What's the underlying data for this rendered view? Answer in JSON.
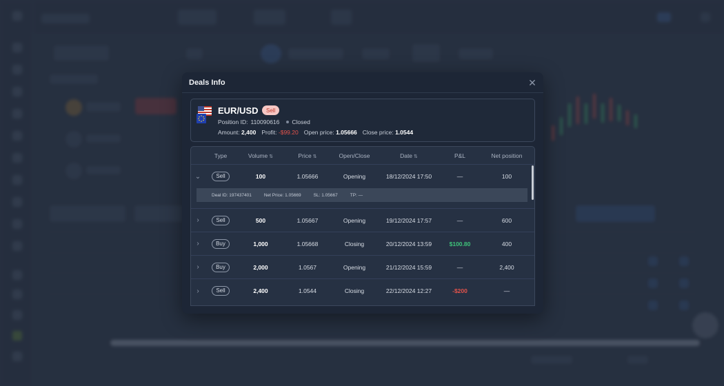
{
  "modal": {
    "title": "Deals Info",
    "close_icon": "close-icon"
  },
  "position": {
    "pair": "EUR/USD",
    "side": "Sell",
    "position_id_label": "Position ID:",
    "position_id": "110090616",
    "status": "Closed",
    "amount_label": "Amount:",
    "amount": "2,400",
    "profit_label": "Profit:",
    "profit": "-$99.20",
    "open_price_label": "Open price:",
    "open_price": "1.05666",
    "close_price_label": "Close price:",
    "close_price": "1.0544",
    "flag_icons": [
      "us-flag-icon",
      "eu-flag-icon"
    ]
  },
  "table": {
    "headers": {
      "type": "Type",
      "volume": "Volume",
      "price": "Price",
      "open_close": "Open/Close",
      "date": "Date",
      "pnl": "P&L",
      "net_position": "Net position"
    },
    "sort_icon": "sort-icon",
    "rows": [
      {
        "type": "Sell",
        "volume": "100",
        "price": "1.05666",
        "open_close": "Opening",
        "date": "18/12/2024 17:50",
        "pnl": "—",
        "net_position": "100",
        "expanded": true
      },
      {
        "type": "Sell",
        "volume": "500",
        "price": "1.05667",
        "open_close": "Opening",
        "date": "19/12/2024 17:57",
        "pnl": "—",
        "net_position": "600",
        "expanded": false
      },
      {
        "type": "Buy",
        "volume": "1,000",
        "price": "1.05668",
        "open_close": "Closing",
        "date": "20/12/2024 13:59",
        "pnl": "$100.80",
        "net_position": "400",
        "expanded": false
      },
      {
        "type": "Buy",
        "volume": "2,000",
        "price": "1.0567",
        "open_close": "Opening",
        "date": "21/12/2024 15:59",
        "pnl": "—",
        "net_position": "2,400",
        "expanded": false
      },
      {
        "type": "Sell",
        "volume": "2,400",
        "price": "1.0544",
        "open_close": "Closing",
        "date": "22/12/2024 12:27",
        "pnl": "-$200",
        "net_position": "—",
        "expanded": false
      }
    ],
    "detail": {
      "deal_id": "Deal ID: 197437401",
      "net_price": "Net Price: 1.05669",
      "sl": "SL: 1.05667",
      "tp": "TP: —"
    }
  },
  "colors": {
    "positive": "#3fc37a",
    "negative": "#e5534b",
    "modal_bg": "#1d2636",
    "sell_badge_bg": "#f6c7c4"
  }
}
